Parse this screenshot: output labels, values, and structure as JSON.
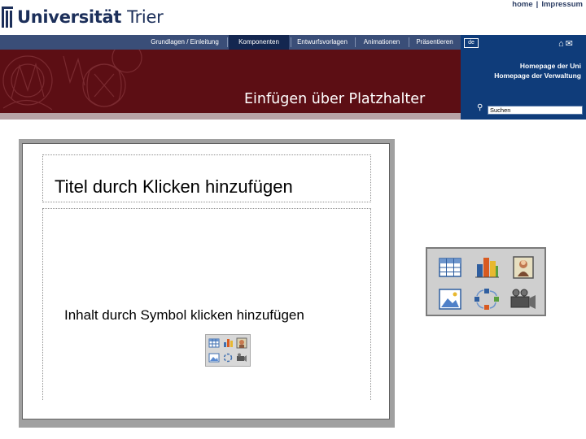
{
  "header": {
    "logo": {
      "bold": "Universität",
      "light": "Trier"
    },
    "toplinks": [
      {
        "label": "home"
      },
      {
        "label": "Impressum"
      }
    ],
    "toplink_separator": "|",
    "nav": [
      {
        "label": "Grundlagen / Einleitung",
        "active": false
      },
      {
        "label": "Komponenten",
        "active": true
      },
      {
        "label": "Entwurfsvorlagen",
        "active": false
      },
      {
        "label": "Animationen",
        "active": false
      },
      {
        "label": "Präsentieren",
        "active": false
      }
    ],
    "banner_title": "Einfügen über Platzhalter"
  },
  "right_panel": {
    "lang": "de",
    "links": [
      "Homepage der Uni",
      "Homepage der Verwaltung"
    ],
    "search_value": "Suchen"
  },
  "slide": {
    "title_placeholder": "Titel durch Klicken hinzufügen",
    "content_placeholder": "Inhalt durch Symbol klicken hinzufügen"
  },
  "palette_icons": [
    "insert-table-icon",
    "insert-chart-icon",
    "insert-clipart-icon",
    "insert-picture-icon",
    "insert-smartart-icon",
    "insert-media-icon"
  ],
  "colors": {
    "navy": "#1c2f5a",
    "nav_bar": "#3a4e78",
    "nav_active": "#142750",
    "banner": "#5c0e14",
    "right_panel": "#0f3c7a"
  }
}
